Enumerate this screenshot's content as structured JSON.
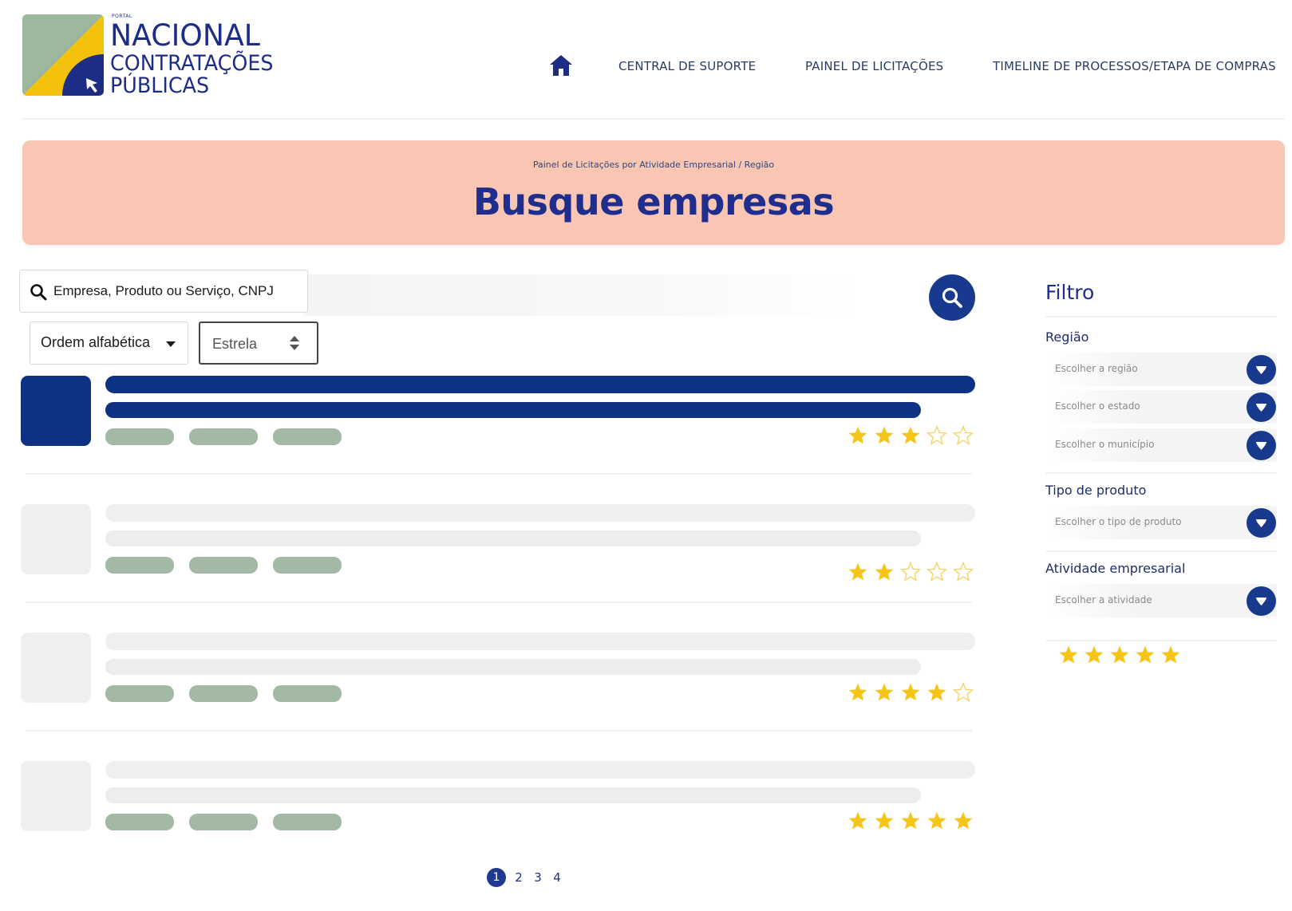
{
  "brand": {
    "portal": "PORTAL",
    "line1": "NACIONAL",
    "line2": "CONTRATAÇÕES",
    "line3": "PÚBLICAS"
  },
  "nav": {
    "home_icon": "home-icon",
    "items": [
      {
        "label": "CENTRAL DE SUPORTE"
      },
      {
        "label": "PAINEL DE LICITAÇÕES"
      },
      {
        "label": "TIMELINE DE PROCESSOS/ETAPA DE COMPRAS"
      }
    ]
  },
  "banner": {
    "breadcrumb": "Painel de Licitações por Atividade Empresarial / Região",
    "title": "Busque empresas"
  },
  "search": {
    "placeholder": "Empresa, Produto ou Serviço, CNPJ",
    "value": "",
    "search_icon": "search-icon"
  },
  "sort": {
    "order_value": "Ordem alfabética",
    "star_value": "Estrela"
  },
  "results": [
    {
      "state": "active",
      "rating": 3,
      "max": 5
    },
    {
      "state": "placeholder",
      "rating": 2,
      "max": 5
    },
    {
      "state": "placeholder",
      "rating": 4,
      "max": 5
    },
    {
      "state": "placeholder",
      "rating": 5,
      "max": 5
    }
  ],
  "pagination": {
    "pages": [
      "1",
      "2",
      "3",
      "4"
    ],
    "current": "1"
  },
  "filter": {
    "title": "Filtro",
    "groups": [
      {
        "label": "Região",
        "dropdowns": [
          "Escolher a região",
          "Escolher o estado",
          "Escolher o município"
        ]
      },
      {
        "label": "Tipo de produto",
        "dropdowns": [
          "Escolher o tipo de produto"
        ]
      },
      {
        "label": "Atividade empresarial",
        "dropdowns": [
          "Escolher a atividade"
        ]
      }
    ],
    "star_rating": 5
  },
  "colors": {
    "brand_blue": "#1d2c84",
    "accent_navy": "#0e3283",
    "banner_peach": "#f8c6b3",
    "star_gold": "#f5c518",
    "tag_green": "#a3b8a5",
    "logo_yellow": "#f4c20d"
  }
}
